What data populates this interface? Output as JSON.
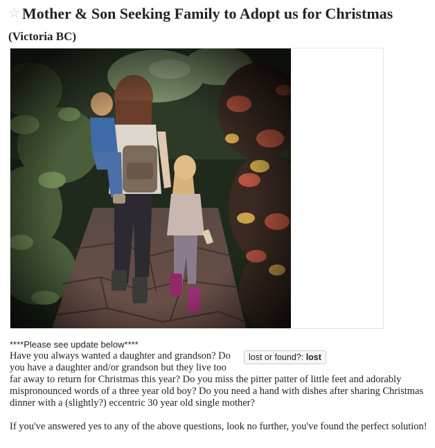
{
  "posting": {
    "title": "Mother & Son Seeking Family to Adopt us for Christmas",
    "location": "(Victoria BC)",
    "favorite_icon": "star-icon"
  },
  "gallery": {
    "photo_label": "mother-and-children-walking-garden-photo"
  },
  "attributes": {
    "label": "lost or found?:",
    "value": "lost"
  },
  "body": {
    "line1": "****Please see update below****",
    "line2": "Have you always wanted a daughter and grandson? Do",
    "line3": "you have a daughter and/or grandson but they live too",
    "line4": "far away to return for Christmas this year? Do you miss the pitter patter of little feet and adorably",
    "line5": "mispronounced words of a three year old boy? Do you need a hand with dishes after sharing Christmas",
    "line6": "dinner with a (slightly?) eccentric 30 year old single mother?",
    "line7": "If you've answered yes to any of the above questions, look no further, you've found the perfect solution!"
  },
  "colors": {
    "text": "#222222",
    "star": "#cccccc",
    "gallery_border": "#e4e4e4",
    "attr_background": "#f7f7f7"
  }
}
